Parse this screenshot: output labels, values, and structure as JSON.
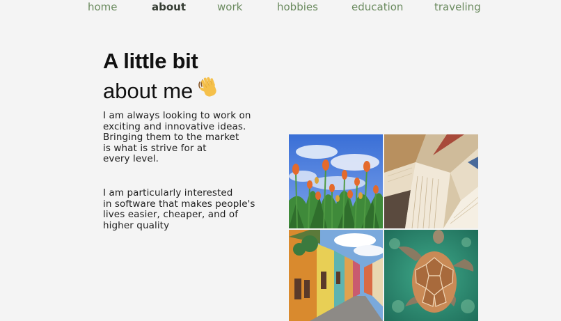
{
  "nav": {
    "items": [
      {
        "label": "home"
      },
      {
        "label": "about"
      },
      {
        "label": "work"
      },
      {
        "label": "hobbies"
      },
      {
        "label": "education"
      },
      {
        "label": "traveling"
      }
    ],
    "active": "about",
    "link_color": "#6a8a5e",
    "active_color": "#353c33"
  },
  "hero": {
    "title_line1": "A little bit",
    "title_line2": "about me",
    "emoji": "waving-hand-icon"
  },
  "paragraphs": {
    "first": "I am always looking to work on\nexciting and innovative ideas.\nBringing them to the market\nis what is strive for at\nevery level.",
    "second": "I am particularly interested\nin software that makes people's\nlives easier, cheaper, and of\nhigher quality"
  },
  "gallery": {
    "images": [
      {
        "subject": "tulips-photo"
      },
      {
        "subject": "books-photo"
      },
      {
        "subject": "colorful-street-photo"
      },
      {
        "subject": "sea-turtle-photo"
      }
    ]
  }
}
